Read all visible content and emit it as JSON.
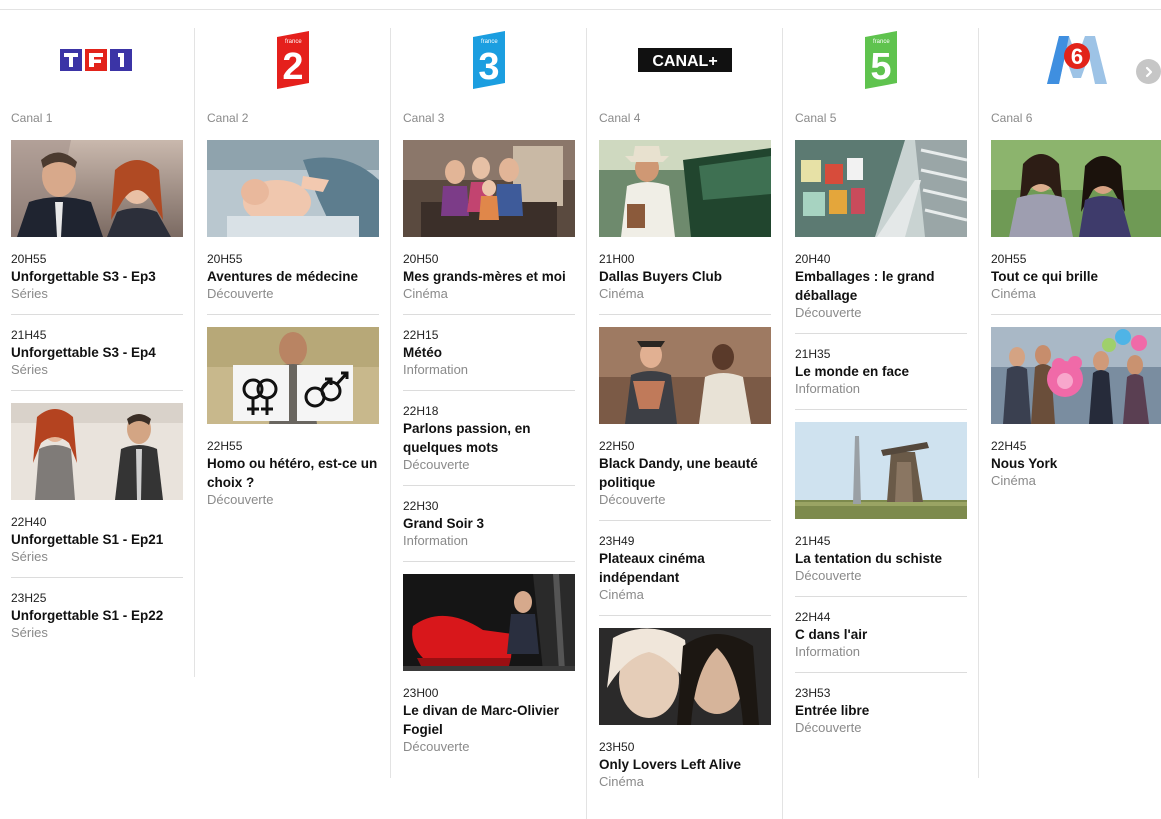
{
  "channels": [
    {
      "label": "Canal 1",
      "logo_text": "TF1",
      "programs": [
        {
          "time": "20H55",
          "title": "Unforgettable S3 - Ep3",
          "genre": "Séries"
        },
        {
          "time": "21H45",
          "title": "Unforgettable S3 - Ep4",
          "genre": "Séries"
        },
        {
          "time": "22H40",
          "title": "Unforgettable S1 - Ep21",
          "genre": "Séries"
        },
        {
          "time": "23H25",
          "title": "Unforgettable S1 - Ep22",
          "genre": "Séries"
        }
      ]
    },
    {
      "label": "Canal 2",
      "logo_text": "2",
      "logo_small": "france",
      "programs": [
        {
          "time": "20H55",
          "title": "Aventures de médecine",
          "genre": "Découverte"
        },
        {
          "time": "22H55",
          "title": "Homo ou hétéro, est-ce un choix ?",
          "genre": "Découverte"
        }
      ]
    },
    {
      "label": "Canal 3",
      "logo_text": "3",
      "logo_small": "france",
      "programs": [
        {
          "time": "20H50",
          "title": "Mes grands-mères et moi",
          "genre": "Cinéma"
        },
        {
          "time": "22H15",
          "title": "Météo",
          "genre": "Information"
        },
        {
          "time": "22H18",
          "title": "Parlons passion, en quelques mots",
          "genre": "Découverte"
        },
        {
          "time": "22H30",
          "title": "Grand Soir 3",
          "genre": "Information"
        },
        {
          "time": "23H00",
          "title": "Le divan de Marc-Olivier Fogiel",
          "genre": "Découverte"
        }
      ]
    },
    {
      "label": "Canal 4",
      "logo_text": "CANAL+",
      "programs": [
        {
          "time": "21H00",
          "title": "Dallas Buyers Club",
          "genre": "Cinéma"
        },
        {
          "time": "22H50",
          "title": "Black Dandy, une beauté politique",
          "genre": "Découverte"
        },
        {
          "time": "23H49",
          "title": "Plateaux cinéma indépendant",
          "genre": "Cinéma"
        },
        {
          "time": "23H50",
          "title": "Only Lovers Left Alive",
          "genre": "Cinéma"
        }
      ]
    },
    {
      "label": "Canal 5",
      "logo_text": "5",
      "logo_small": "france",
      "programs": [
        {
          "time": "20H40",
          "title": "Emballages : le grand déballage",
          "genre": "Découverte"
        },
        {
          "time": "21H35",
          "title": "Le monde en face",
          "genre": "Information"
        },
        {
          "time": "21H45",
          "title": "La tentation du schiste",
          "genre": "Découverte"
        },
        {
          "time": "22H44",
          "title": "C dans l'air",
          "genre": "Information"
        },
        {
          "time": "23H53",
          "title": "Entrée libre",
          "genre": "Découverte"
        }
      ]
    },
    {
      "label": "Canal 6",
      "logo_text": "6",
      "programs": [
        {
          "time": "20H55",
          "title": "Tout ce qui brille",
          "genre": "Cinéma"
        },
        {
          "time": "22H45",
          "title": "Nous York",
          "genre": "Cinéma"
        }
      ]
    }
  ],
  "icons": {
    "next": "chevron-right-icon"
  },
  "colors": {
    "tf1_blue": "#3b34a6",
    "tf1_red": "#e2231a",
    "france2_red": "#e5201c",
    "france3_blue": "#1b9ee0",
    "canal_black": "#111111",
    "france5_green": "#5fc34e",
    "m6_red": "#e2231a",
    "m6_blue": "#3f8fe0",
    "label_grey": "#8a8a8a",
    "divider": "#e3e3e3"
  }
}
